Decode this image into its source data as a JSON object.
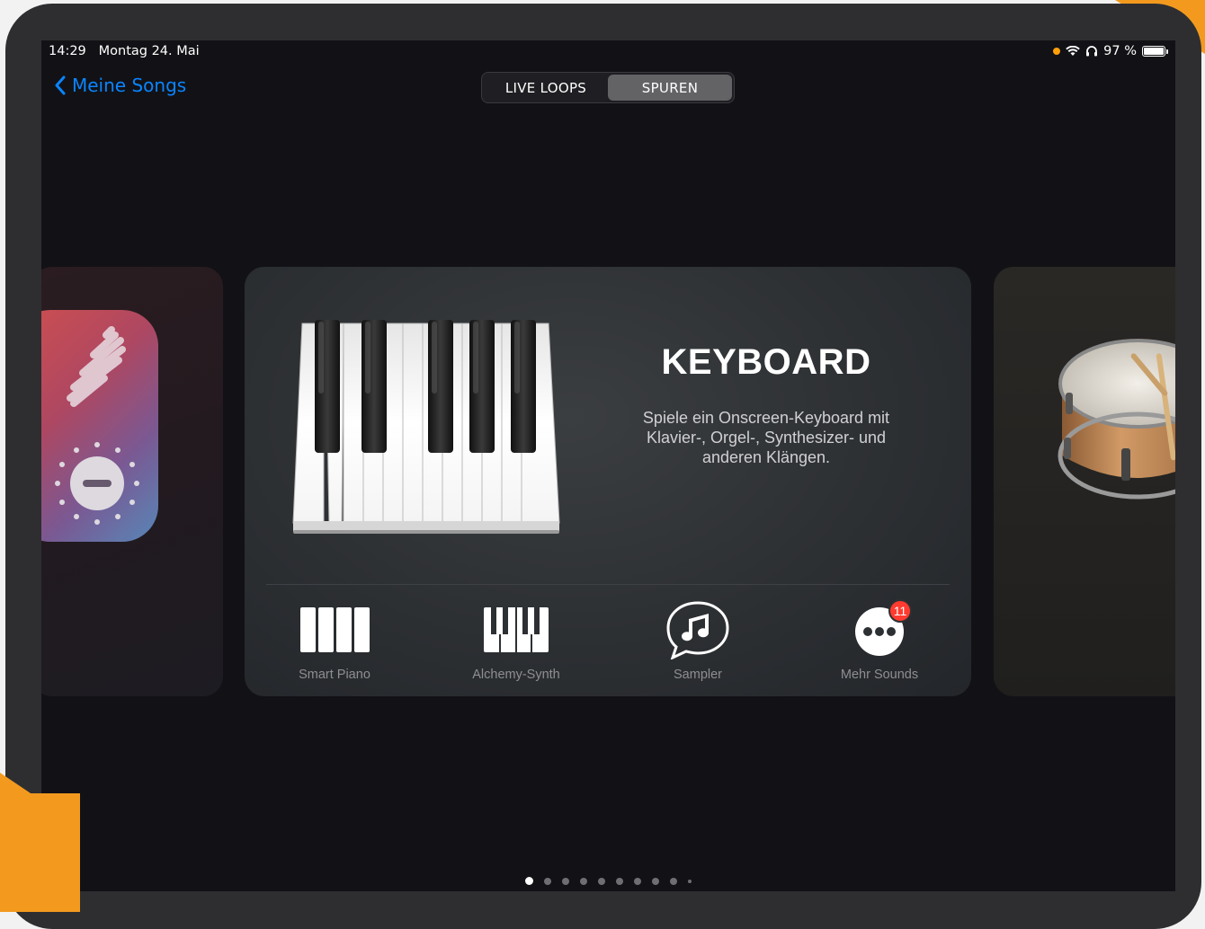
{
  "status_bar": {
    "time": "14:29",
    "date": "Montag 24. Mai",
    "battery": "97 %"
  },
  "nav": {
    "back_label": "Meine Songs"
  },
  "segmented": {
    "items": [
      {
        "label": "LIVE LOOPS",
        "active": false
      },
      {
        "label": "SPUREN",
        "active": true
      }
    ]
  },
  "instrument": {
    "title": "KEYBOARD",
    "description": "Spiele ein Onscreen-Keyboard mit Klavier-, Orgel-, Synthesizer- und anderen Klängen."
  },
  "options": [
    {
      "label": "Smart Piano",
      "icon": "smart-piano-icon"
    },
    {
      "label": "Alchemy-Synth",
      "icon": "alchemy-synth-icon"
    },
    {
      "label": "Sampler",
      "icon": "sampler-icon"
    },
    {
      "label": "Mehr Sounds",
      "icon": "more-sounds-icon",
      "badge": "11"
    }
  ],
  "pager": {
    "count": 10,
    "active_index": 0
  },
  "colors": {
    "accent": "#0a84ff",
    "badge": "#ff3b30",
    "frame_corner": "#f39a1e"
  }
}
